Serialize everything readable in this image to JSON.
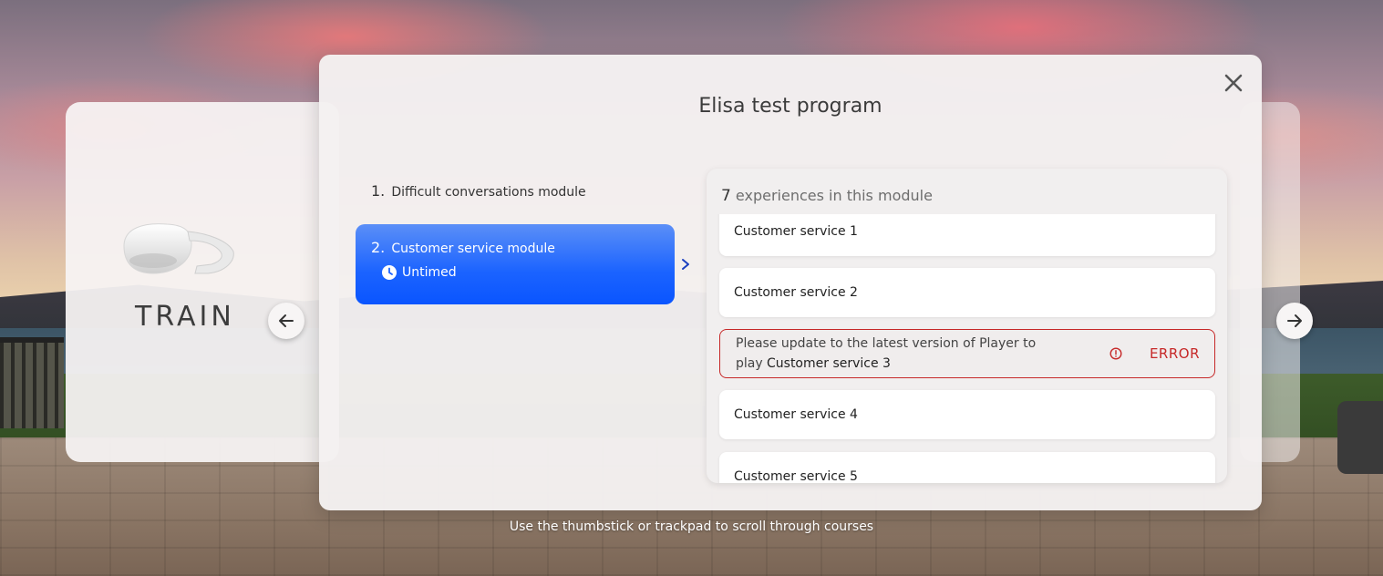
{
  "program": {
    "title": "Elisa test program",
    "close_icon": "close-icon"
  },
  "carousel": {
    "left_card_label": "TRAIN",
    "left_card_icon": "vr-headset-icon",
    "prev_icon": "arrow-left-icon",
    "next_icon": "arrow-right-icon"
  },
  "modules": [
    {
      "number": "1.",
      "name": "Difficult conversations module",
      "active": false
    },
    {
      "number": "2.",
      "name": "Customer service module",
      "active": true,
      "timing": "Untimed",
      "timing_icon": "clock-icon"
    }
  ],
  "experiences": {
    "count": "7",
    "count_suffix": "experiences in this module",
    "items": [
      {
        "label": "Customer service 1"
      },
      {
        "label": "Customer service 2"
      },
      {
        "error": true,
        "message_prefix": "Please update to the latest version of Player to play",
        "message_item": "Customer service 3",
        "status": "ERROR",
        "status_icon": "alert-circle-icon"
      },
      {
        "label": "Customer service 4"
      },
      {
        "label": "Customer service 5"
      }
    ]
  },
  "hint": "Use the thumbstick or trackpad to scroll through courses",
  "colors": {
    "accent": "#1b63ff",
    "error": "#c62828"
  }
}
